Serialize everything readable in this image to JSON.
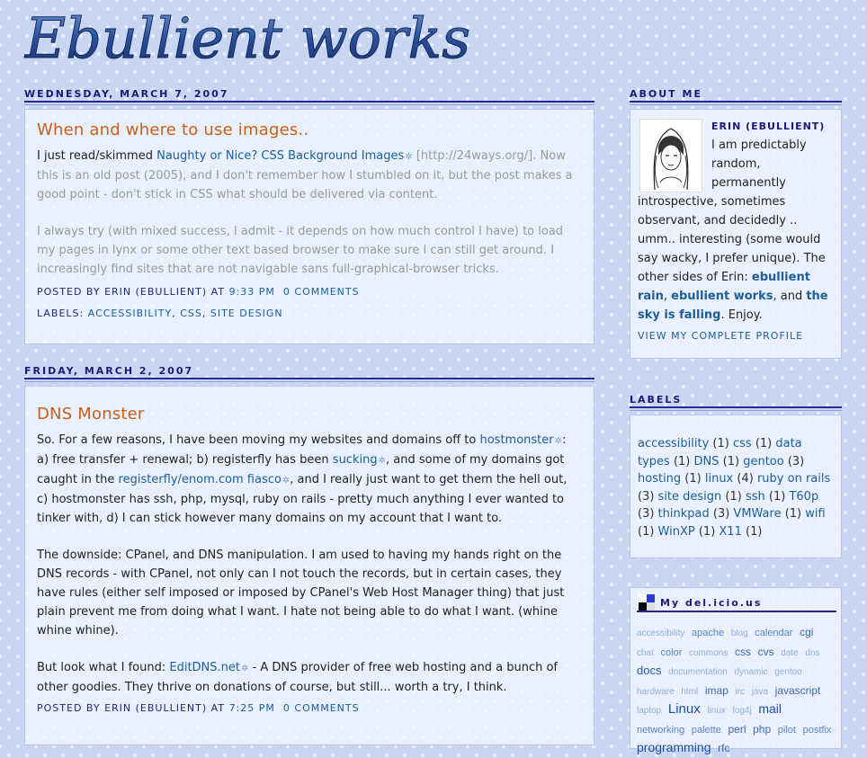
{
  "site": {
    "title": "Ebullient works"
  },
  "posts": [
    {
      "date": "Wednesday, March 7, 2007",
      "title": "When and where to use images..",
      "intro_prefix": "I just read/skimmed ",
      "intro_link": "Naughty or Nice? CSS Background Images",
      "intro_url": "[http://24ways.org/]",
      "intro_rest": ". Now this is an old post (2005), and I don't remember how I stumbled on it, but the post makes a good point - don't stick in CSS what should be delivered via content.",
      "para2": "I always try (with mixed success, I admit - it depends on how much control I have) to load my pages in lynx or some other text based browser to make sure I can still get around. I increasingly find sites that are not navigable sans full-graphical-browser tricks.",
      "footer": {
        "posted_by": "Posted by Erin (Ebullient) at",
        "time": "9:33 PM",
        "comments": "0 Comments",
        "labels_prefix": "Labels:",
        "labels": [
          "accessibility",
          "CSS",
          "site design"
        ]
      }
    },
    {
      "date": "Friday, March 2, 2007",
      "title": "DNS Monster",
      "p1_a": "So. For a few reasons, I have been moving my websites and domains off to ",
      "p1_link1": "hostmonster",
      "p1_b": ": a) free transfer + renewal; b) registerfly has been ",
      "p1_link2": "sucking",
      "p1_c": ", and some of my domains got caught in the ",
      "p1_link3": "registerfly/enom.com fiasco",
      "p1_d": ", and I really just want to get them the hell out, c) hostmonster has ssh, php, mysql, ruby on rails - pretty much anything I ever wanted to tinker with, d) I can stick however many domains on my account that I want to.",
      "p2": "The downside: CPanel, and DNS manipulation. I am used to having my hands right on the DNS records - with CPanel, not only can I not touch the records, but in certain cases, they have rules (either self imposed or imposed by CPanel's Web Host Manager thing) that just plain prevent me from doing what I want. I hate not being able to do what I want. (whine whine whine).",
      "p3_a": "But look what I found: ",
      "p3_link": "EditDNS.net",
      "p3_b": " - A DNS provider of free web hosting and a bunch of other goodies. They thrive on donations of course, but still... worth a try, I think.",
      "footer": {
        "posted_by": "Posted by Erin (Ebullient) at",
        "time": "7:25 PM",
        "comments": "0 Comments"
      }
    }
  ],
  "about": {
    "heading": "About Me",
    "name": "Erin (Ebullient)",
    "text": "I am predictably random, permanently introspective, sometimes observant, and decidedly .. umm.. interesting (some would say wacky, I prefer unique). The other sides of Erin: ",
    "link1": "ebullient rain",
    "sep1": ", ",
    "link2": "ebullient works",
    "sep2": ", and ",
    "link3": "the sky is falling",
    "end": ". Enjoy.",
    "view_profile": "View my complete profile"
  },
  "labels": {
    "heading": "Labels",
    "items": [
      {
        "name": "accessibility",
        "count": "(1)"
      },
      {
        "name": "css",
        "count": "(1)"
      },
      {
        "name": "data types",
        "count": "(1)"
      },
      {
        "name": "DNS",
        "count": "(1)"
      },
      {
        "name": "gentoo",
        "count": "(3)"
      },
      {
        "name": "hosting",
        "count": "(1)"
      },
      {
        "name": "linux",
        "count": "(4)"
      },
      {
        "name": "ruby on rails",
        "count": "(3)"
      },
      {
        "name": "site design",
        "count": "(1)"
      },
      {
        "name": "ssh",
        "count": "(1)"
      },
      {
        "name": "T60p",
        "count": "(3)"
      },
      {
        "name": "thinkpad",
        "count": "(3)"
      },
      {
        "name": "VMWare",
        "count": "(1)"
      },
      {
        "name": "wifi",
        "count": "(1)"
      },
      {
        "name": "WinXP",
        "count": "(1)"
      },
      {
        "name": "X11",
        "count": "(1)"
      }
    ]
  },
  "delicious": {
    "heading": "My del.icio.us",
    "tags": [
      {
        "t": "accessibility",
        "size": 10,
        "color": "#8fb0dc"
      },
      {
        "t": "apache",
        "size": 11,
        "color": "#5a86c4"
      },
      {
        "t": "blog",
        "size": 10,
        "color": "#8fb0dc"
      },
      {
        "t": "calendar",
        "size": 11,
        "color": "#5a86c4"
      },
      {
        "t": "cgi",
        "size": 12,
        "color": "#3a6ab4"
      },
      {
        "t": "chat",
        "size": 10,
        "color": "#8fb0dc"
      },
      {
        "t": "color",
        "size": 11,
        "color": "#5a86c4"
      },
      {
        "t": "commons",
        "size": 10,
        "color": "#8fb0dc"
      },
      {
        "t": "css",
        "size": 12,
        "color": "#3a6ab4"
      },
      {
        "t": "cvs",
        "size": 12,
        "color": "#3a6ab4"
      },
      {
        "t": "date",
        "size": 10,
        "color": "#8fb0dc"
      },
      {
        "t": "dns",
        "size": 10,
        "color": "#8fb0dc"
      },
      {
        "t": "docs",
        "size": 13,
        "color": "#2a5aaa"
      },
      {
        "t": "documentation",
        "size": 10,
        "color": "#8fb0dc"
      },
      {
        "t": "dynamic",
        "size": 10,
        "color": "#8fb0dc"
      },
      {
        "t": "gentoo",
        "size": 10,
        "color": "#8fb0dc"
      },
      {
        "t": "hardware",
        "size": 10,
        "color": "#8fb0dc"
      },
      {
        "t": "html",
        "size": 10,
        "color": "#8fb0dc"
      },
      {
        "t": "imap",
        "size": 12,
        "color": "#3a6ab4"
      },
      {
        "t": "irc",
        "size": 10,
        "color": "#8fb0dc"
      },
      {
        "t": "java",
        "size": 10,
        "color": "#8fb0dc"
      },
      {
        "t": "javascript",
        "size": 12,
        "color": "#3a6ab4"
      },
      {
        "t": "laptop",
        "size": 10,
        "color": "#8fb0dc"
      },
      {
        "t": "Linux",
        "size": 15,
        "color": "#1e4ea0"
      },
      {
        "t": "linux",
        "size": 10,
        "color": "#8fb0dc"
      },
      {
        "t": "log4j",
        "size": 10,
        "color": "#8fb0dc"
      },
      {
        "t": "mail",
        "size": 14,
        "color": "#1e4ea0"
      },
      {
        "t": "networking",
        "size": 11,
        "color": "#5a86c4"
      },
      {
        "t": "palette",
        "size": 11,
        "color": "#5a86c4"
      },
      {
        "t": "perl",
        "size": 12,
        "color": "#3a6ab4"
      },
      {
        "t": "php",
        "size": 12,
        "color": "#3a6ab4"
      },
      {
        "t": "pilot",
        "size": 11,
        "color": "#5a86c4"
      },
      {
        "t": "postfix",
        "size": 11,
        "color": "#5a86c4"
      },
      {
        "t": "programming",
        "size": 14,
        "color": "#1e4ea0"
      },
      {
        "t": "rfc",
        "size": 12,
        "color": "#3a6ab4"
      }
    ]
  },
  "colors": {
    "accent": "#c8601a",
    "link": "#1a5e9a",
    "heading": "#1e1a78"
  }
}
